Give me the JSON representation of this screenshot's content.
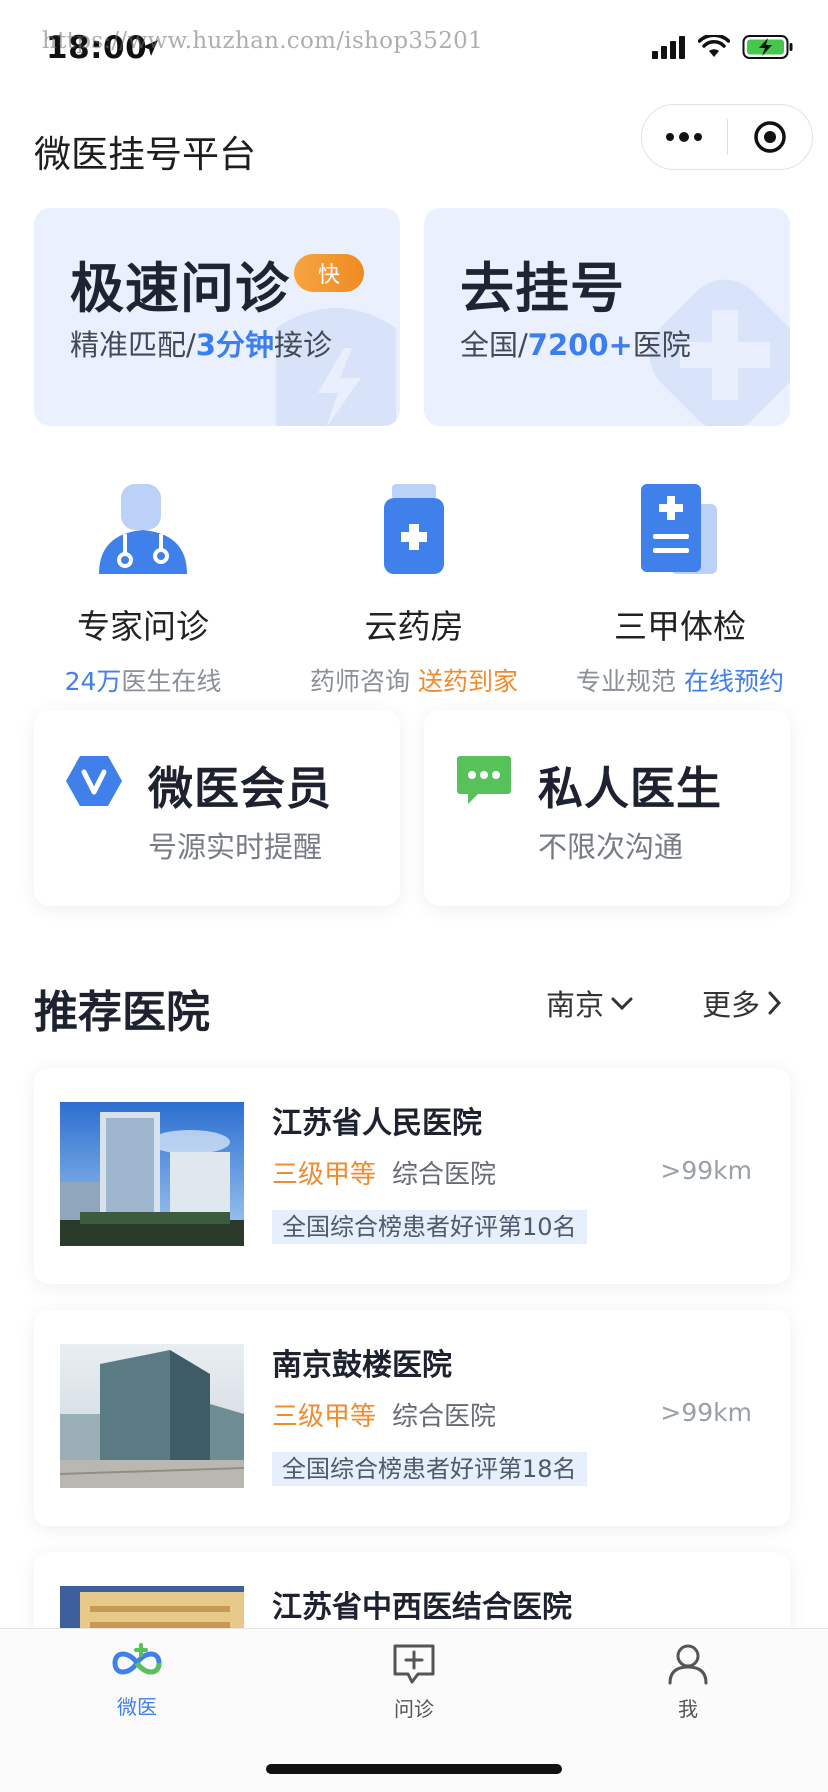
{
  "status_bar": {
    "time": "18:00",
    "watermark": "https://www.huzhan.com/ishop35201"
  },
  "nav": {
    "title": "微医挂号平台"
  },
  "top_cards": [
    {
      "title": "极速问诊",
      "badge": "快",
      "sub_before": "精准匹配/",
      "sub_highlight": "3分钟",
      "sub_after": "接诊"
    },
    {
      "title": "去挂号",
      "sub_before": "全国/",
      "sub_highlight": "7200+",
      "sub_after": "医院"
    }
  ],
  "services": [
    {
      "name": "专家问诊",
      "desc_a": "24万",
      "desc_b": "医生在线",
      "icon": "doctor-icon"
    },
    {
      "name": "云药房",
      "desc_a": "药师咨询 ",
      "desc_b": "送药到家",
      "icon": "medicine-bottle-icon"
    },
    {
      "name": "三甲体检",
      "desc_a": "专业规范 ",
      "desc_b": "在线预约",
      "icon": "medical-report-icon"
    }
  ],
  "member_cards": [
    {
      "title": "微医会员",
      "sub": "号源实时提醒",
      "icon": "vip-v-icon"
    },
    {
      "title": "私人医生",
      "sub": "不限次沟通",
      "icon": "chat-bubble-icon"
    }
  ],
  "section": {
    "title": "推荐医院",
    "city": "南京",
    "more": "更多"
  },
  "hospitals": [
    {
      "name": "江苏省人民医院",
      "level": "三级甲等",
      "type": "综合医院",
      "distance": ">99km",
      "tag": "全国综合榜患者好评第10名"
    },
    {
      "name": "南京鼓楼医院",
      "level": "三级甲等",
      "type": "综合医院",
      "distance": ">99km",
      "tag": "全国综合榜患者好评第18名"
    },
    {
      "name": "江苏省中西医结合医院"
    }
  ],
  "tabbar": [
    {
      "label": "微医",
      "icon": "weiyi-logo-icon",
      "active": true
    },
    {
      "label": "问诊",
      "icon": "consult-icon",
      "active": false
    },
    {
      "label": "我",
      "icon": "person-icon",
      "active": false
    }
  ],
  "colors": {
    "accent_blue": "#3f80ea",
    "accent_orange": "#f08c2e",
    "card_bg": "#eaf0fd",
    "wechat_green": "#58c25a"
  }
}
